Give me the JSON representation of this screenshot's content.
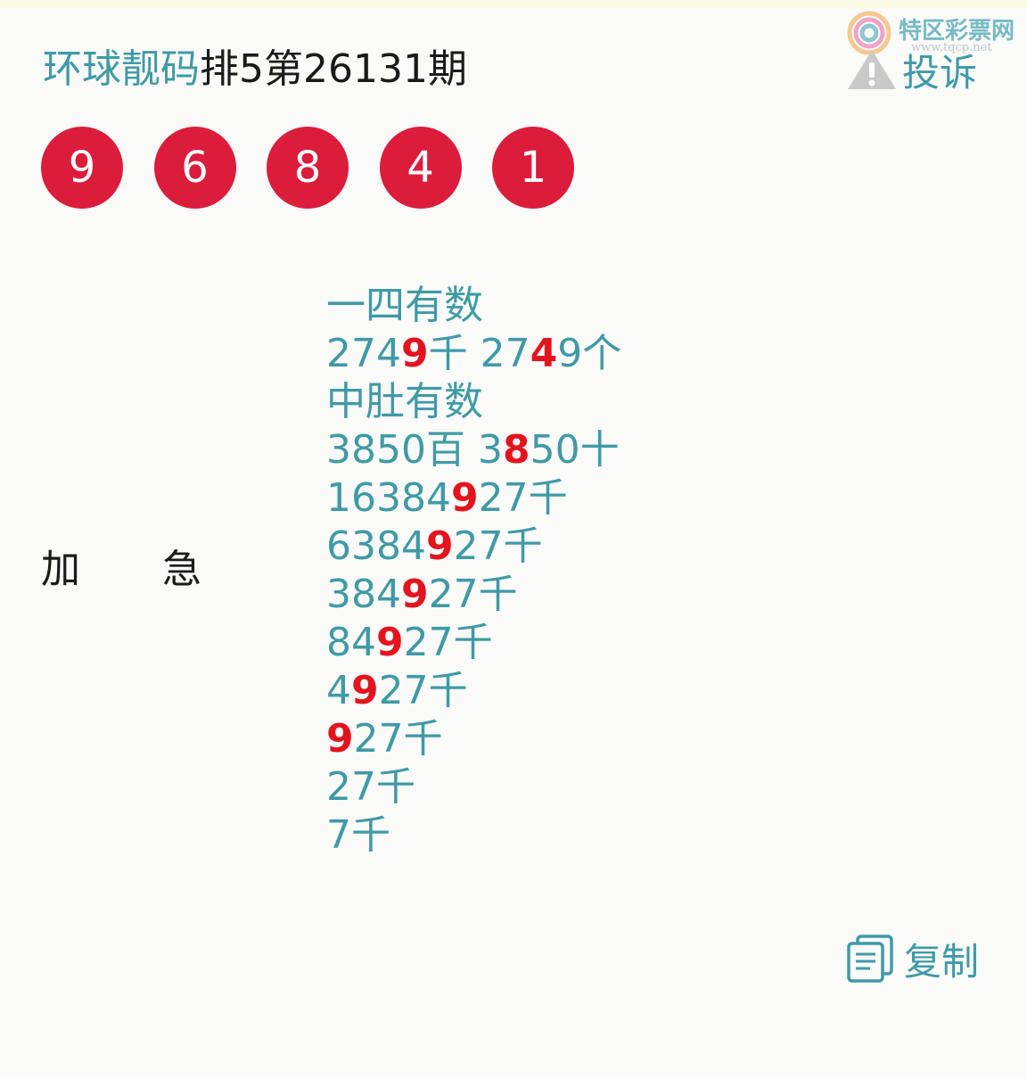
{
  "header": {
    "source_name": "环球靓码",
    "issue_title": "排5第26131期",
    "complain_label": "投诉",
    "complain_icon": "warning-icon"
  },
  "watermark": {
    "name": "特区彩票网",
    "url": "www.tqcp.net"
  },
  "draw": {
    "numbers": [
      "9",
      "6",
      "8",
      "4",
      "1"
    ],
    "ball_color": "#dc1c3b"
  },
  "urgent_label": {
    "char1": "加",
    "char2": "急"
  },
  "recommendations": [
    [
      {
        "t": "一四有数",
        "h": false
      }
    ],
    [
      {
        "t": "274",
        "h": false
      },
      {
        "t": "9",
        "h": true
      },
      {
        "t": "千 27",
        "h": false
      },
      {
        "t": "4",
        "h": true
      },
      {
        "t": "9个",
        "h": false
      }
    ],
    [
      {
        "t": "中肚有数",
        "h": false
      }
    ],
    [
      {
        "t": "3850百 3",
        "h": false
      },
      {
        "t": "8",
        "h": true
      },
      {
        "t": "50十",
        "h": false
      }
    ],
    [
      {
        "t": "16384",
        "h": false
      },
      {
        "t": "9",
        "h": true
      },
      {
        "t": "27千",
        "h": false
      }
    ],
    [
      {
        "t": "6384",
        "h": false
      },
      {
        "t": "9",
        "h": true
      },
      {
        "t": "27千",
        "h": false
      }
    ],
    [
      {
        "t": "384",
        "h": false
      },
      {
        "t": "9",
        "h": true
      },
      {
        "t": "27千",
        "h": false
      }
    ],
    [
      {
        "t": "84",
        "h": false
      },
      {
        "t": "9",
        "h": true
      },
      {
        "t": "27千",
        "h": false
      }
    ],
    [
      {
        "t": "4",
        "h": false
      },
      {
        "t": "9",
        "h": true
      },
      {
        "t": "27千",
        "h": false
      }
    ],
    [
      {
        "t": "9",
        "h": true
      },
      {
        "t": "27千",
        "h": false
      }
    ],
    [
      {
        "t": "27千",
        "h": false
      }
    ],
    [
      {
        "t": "7千",
        "h": false
      }
    ]
  ],
  "footer": {
    "copy_label": "复制",
    "copy_icon": "copy-icon"
  },
  "colors": {
    "accent": "#3f9aa6",
    "highlight": "#e3141e",
    "text": "#1a1a1a",
    "background": "#fafaf8"
  }
}
